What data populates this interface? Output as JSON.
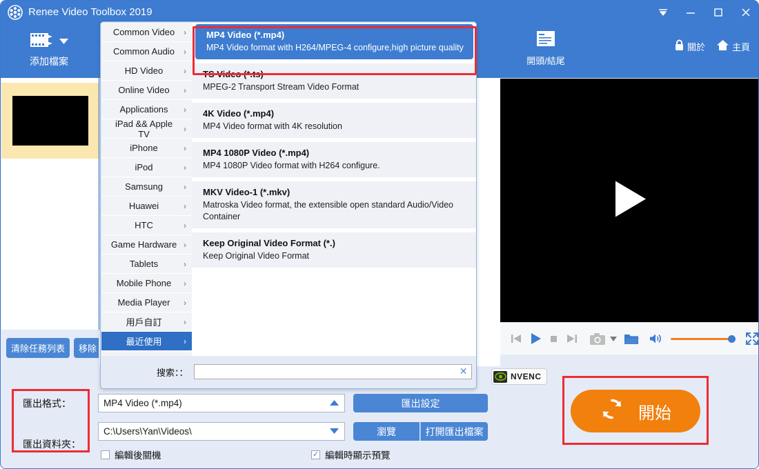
{
  "window": {
    "title": "Renee Video Toolbox 2019",
    "logo_icon": "film-reel-icon",
    "controls": [
      {
        "name": "minimize-to-tray-button",
        "icon": "chevron-down-icon"
      },
      {
        "name": "minimize-button",
        "icon": "minimize-icon"
      },
      {
        "name": "maximize-button",
        "icon": "maximize-icon"
      },
      {
        "name": "close-button",
        "icon": "close-icon"
      }
    ]
  },
  "toolbar": {
    "add_file_label": "添加檔案",
    "add_file_icon": "add-film-icon",
    "add_file_caret_icon": "caret-down-icon",
    "intro_outro_label": "開頭/結尾",
    "intro_outro_icon": "document-icon",
    "about_label": "關於",
    "about_icon": "lock-icon",
    "home_label": "主頁",
    "home_icon": "home-icon"
  },
  "task_list": {
    "clear_list_label": "清除任務列表",
    "remove_label": "移除",
    "thumbnail_name": "task-thumbnail"
  },
  "preview": {
    "play_icon": "play-triangle-icon",
    "controls": [
      {
        "name": "previous-button",
        "icon": "skip-previous-icon"
      },
      {
        "name": "play-button",
        "icon": "play-icon"
      },
      {
        "name": "stop-button",
        "icon": "stop-icon"
      },
      {
        "name": "next-button",
        "icon": "skip-next-icon"
      },
      {
        "name": "snapshot-button",
        "icon": "camera-icon"
      },
      {
        "name": "snapshot-dropdown",
        "icon": "caret-down-icon"
      },
      {
        "name": "open-folder-button",
        "icon": "folder-icon"
      },
      {
        "name": "volume-button",
        "icon": "speaker-icon"
      },
      {
        "name": "fullscreen-button",
        "icon": "fullscreen-icon"
      }
    ]
  },
  "dropdown": {
    "categories": [
      {
        "label": "Common Video",
        "active": false
      },
      {
        "label": "Common Audio",
        "active": false
      },
      {
        "label": "HD Video",
        "active": false
      },
      {
        "label": "Online Video",
        "active": false
      },
      {
        "label": "Applications",
        "active": false
      },
      {
        "label": "iPad && Apple TV",
        "active": false
      },
      {
        "label": "iPhone",
        "active": false
      },
      {
        "label": "iPod",
        "active": false
      },
      {
        "label": "Samsung",
        "active": false
      },
      {
        "label": "Huawei",
        "active": false
      },
      {
        "label": "HTC",
        "active": false
      },
      {
        "label": "Game Hardware",
        "active": false
      },
      {
        "label": "Tablets",
        "active": false
      },
      {
        "label": "Mobile Phone",
        "active": false
      },
      {
        "label": "Media Player",
        "active": false
      },
      {
        "label": "用戶自訂",
        "active": false
      },
      {
        "label": "最近使用",
        "active": true
      }
    ],
    "arrow_icon": "chevron-right-icon",
    "formats": [
      {
        "title": "MP4 Video (*.mp4)",
        "desc": "MP4 Video format with H264/MPEG-4 configure,high picture quality",
        "selected": true
      },
      {
        "title": "TS Video (*.ts)",
        "desc": "MPEG-2 Transport Stream Video Format",
        "selected": false
      },
      {
        "title": "4K Video (*.mp4)",
        "desc": "MP4 Video format with 4K resolution",
        "selected": false
      },
      {
        "title": "MP4 1080P Video (*.mp4)",
        "desc": "MP4 1080P Video format with H264 configure.",
        "selected": false
      },
      {
        "title": "MKV Video-1 (*.mkv)",
        "desc": "Matroska Video format, the extensible open standard Audio/Video Container",
        "selected": false
      },
      {
        "title": "Keep Original Video Format (*.)",
        "desc": "Keep Original Video Format",
        "selected": false
      }
    ],
    "search_label": "搜索：：",
    "search_value": "",
    "search_placeholder": "",
    "clear_icon": "close-icon"
  },
  "settings": {
    "export_format_label": "匯出格式：",
    "export_format_value": "MP4 Video (*.mp4)",
    "export_format_arrow_icon": "caret-up-icon",
    "export_folder_label": "匯出資料夾：",
    "export_folder_value": "C:\\Users\\Yan\\Videos\\",
    "export_folder_arrow_icon": "caret-down-icon",
    "export_settings_button": "匯出設定",
    "browse_button": "瀏覽",
    "open_export_button": "打開匯出檔案",
    "shutdown_after_label": "編輯後關機",
    "shutdown_after_checked": false,
    "preview_while_edit_label": "編輯時顯示預覽",
    "preview_while_edit_checked": true,
    "nvenc_label": "NVENC",
    "nvenc_icon": "nvidia-eye-icon",
    "start_label": "開始",
    "start_icon": "refresh-circular-arrows-icon"
  },
  "colors": {
    "header_blue": "#3d7cd0",
    "panel_blue": "#e4ebf7",
    "accent_orange": "#f2800d",
    "highlight_red": "#ee2b34",
    "task_row_yellow": "#fbe8b0",
    "button_blue": "#4a86d4"
  }
}
